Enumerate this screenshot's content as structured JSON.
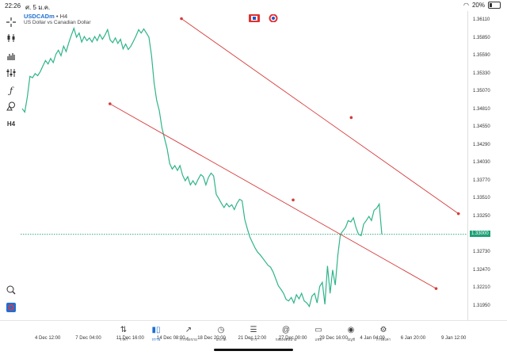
{
  "status": {
    "time": "22:26",
    "date": "ศ. 5 ม.ค.",
    "battery": "20%"
  },
  "header": {
    "symbol": "USDCADm",
    "separator": "•",
    "timeframe": "H4",
    "description": "US Dollar vs Canadian Dollar"
  },
  "toolbar": {
    "icons": [
      "crosshair-icon",
      "candlestick-icon",
      "bar-chart-icon",
      "indicator-icon",
      "function-icon",
      "shapes-icon",
      "timeframe-text"
    ],
    "timeframe_label": "H4"
  },
  "price_labels": [
    "1.36110",
    "1.35850",
    "1.35590",
    "1.35330",
    "1.35070",
    "1.34810",
    "1.34550",
    "1.34290",
    "1.34030",
    "1.33770",
    "1.33510",
    "1.33250",
    "1.32730",
    "1.32470",
    "1.32210",
    "1.31950"
  ],
  "current_price": "1.33000",
  "time_labels": [
    "4 Dec 12:00",
    "7 Dec 04:00",
    "11 Dec 16:00",
    "14 Dec 08:00",
    "18 Dec 20:00",
    "21 Dec 12:00",
    "27 Dec 00:00",
    "29 Dec 16:00",
    "4 Jan 04:00",
    "6 Jan 20:00",
    "9 Jan 12:00"
  ],
  "chart_data": {
    "type": "line",
    "series_color": "#2fb48a",
    "trendline_color": "#d63b3b",
    "ylim": [
      1.3175,
      1.3625
    ],
    "x_count": 140,
    "values": [
      1.3483,
      1.3478,
      1.35,
      1.353,
      1.3528,
      1.3534,
      1.3531,
      1.3537,
      1.3545,
      1.3553,
      1.3548,
      1.3556,
      1.355,
      1.3562,
      1.3568,
      1.356,
      1.3574,
      1.3566,
      1.3579,
      1.359,
      1.36,
      1.3587,
      1.3593,
      1.358,
      1.3588,
      1.3582,
      1.3586,
      1.358,
      1.3588,
      1.3582,
      1.3591,
      1.3584,
      1.359,
      1.3598,
      1.3583,
      1.3579,
      1.3586,
      1.3578,
      1.3584,
      1.357,
      1.3577,
      1.3569,
      1.3574,
      1.3581,
      1.3589,
      1.3598,
      1.3593,
      1.3599,
      1.3593,
      1.3587,
      1.356,
      1.352,
      1.3495,
      1.348,
      1.3455,
      1.344,
      1.3425,
      1.3403,
      1.3395,
      1.34,
      1.3393,
      1.34,
      1.3386,
      1.3378,
      1.3384,
      1.3372,
      1.3378,
      1.3372,
      1.338,
      1.3387,
      1.3384,
      1.3372,
      1.3383,
      1.3389,
      1.3385,
      1.3358,
      1.3352,
      1.3345,
      1.3339,
      1.3345,
      1.334,
      1.3343,
      1.3336,
      1.3345,
      1.3351,
      1.3349,
      1.3322,
      1.3308,
      1.3296,
      1.3288,
      1.328,
      1.3274,
      1.327,
      1.3265,
      1.326,
      1.3255,
      1.3252,
      1.3245,
      1.3235,
      1.3225,
      1.322,
      1.3214,
      1.3205,
      1.3203,
      1.3208,
      1.32,
      1.3212,
      1.3206,
      1.3214,
      1.3203,
      1.32,
      1.3195,
      1.321,
      1.3214,
      1.32,
      1.3224,
      1.323,
      1.3198,
      1.3254,
      1.3214,
      1.3248,
      1.3226,
      1.327,
      1.33,
      1.3305,
      1.331,
      1.332,
      1.3318,
      1.3324,
      1.331,
      1.33,
      1.3298,
      1.3315,
      1.332,
      1.3326,
      1.332,
      1.3335,
      1.3338,
      1.3344,
      1.33
    ],
    "trendlines": [
      {
        "from": [
          1.3614,
          36
        ],
        "mid": [
          1.347,
          74
        ],
        "to": [
          1.333,
          98
        ]
      },
      {
        "from": [
          1.349,
          20
        ],
        "mid": [
          1.335,
          61
        ],
        "to": [
          1.3221,
          93
        ]
      }
    ]
  },
  "nav": [
    {
      "icon": "quotes-icon",
      "label": "ราคา",
      "active": false
    },
    {
      "icon": "chart-icon",
      "label": "กราฟ",
      "active": true
    },
    {
      "icon": "trade-icon",
      "label": "การซื้อขาย",
      "active": false
    },
    {
      "icon": "history-icon",
      "label": "ประวัติ",
      "active": false
    },
    {
      "icon": "news-icon",
      "label": "ข่าว",
      "active": false
    },
    {
      "icon": "mailbox-icon",
      "label": "กล่องจดหมาย",
      "active": false
    },
    {
      "icon": "chat-icon",
      "label": "แชท",
      "active": false
    },
    {
      "icon": "account-icon",
      "label": "บัญชี",
      "active": false
    },
    {
      "icon": "settings-icon",
      "label": "การตั้งค่า",
      "active": false
    }
  ]
}
